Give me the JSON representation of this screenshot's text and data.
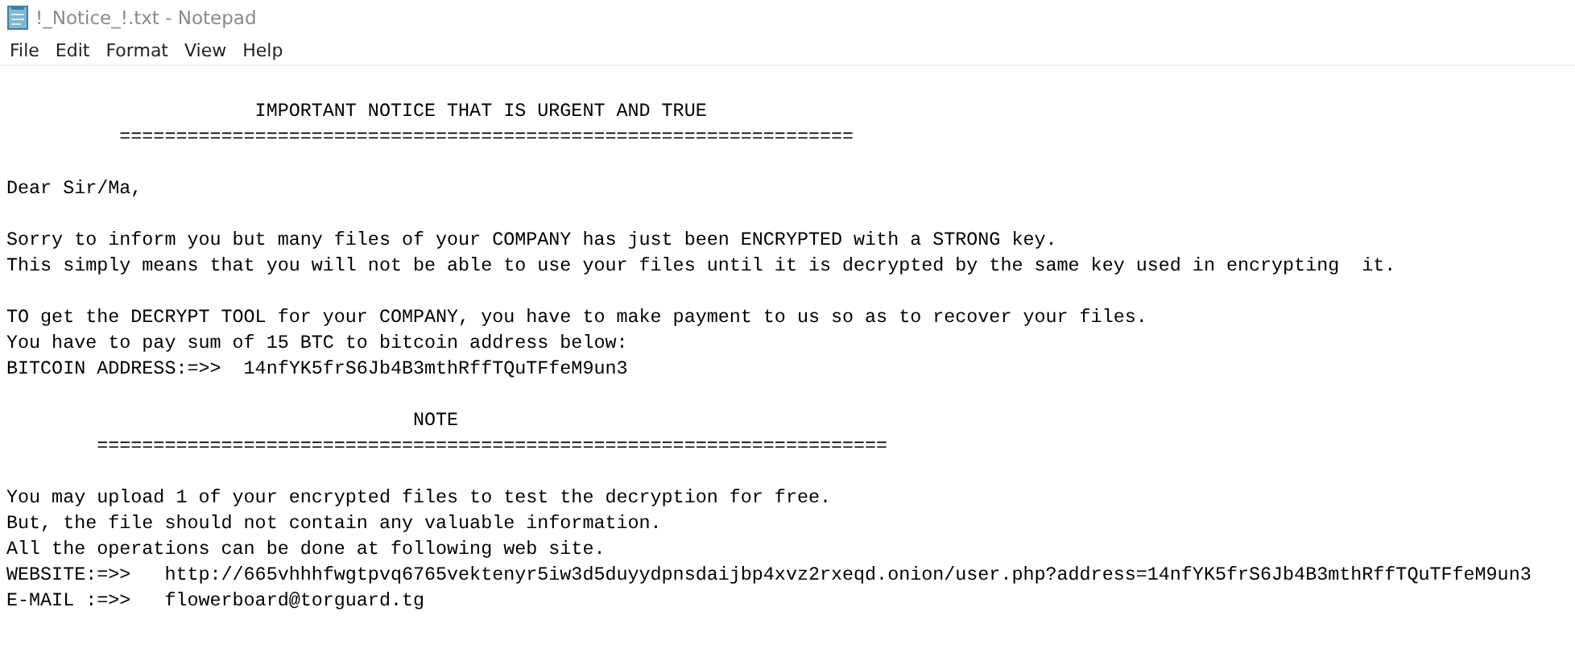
{
  "window": {
    "title": "!_Notice_!.txt - Notepad"
  },
  "menu": [
    "File",
    "Edit",
    "Format",
    "View",
    "Help"
  ],
  "paragraphs": [
    [
      "                      IMPORTANT NOTICE THAT IS URGENT AND TRUE",
      "          ================================================================="
    ],
    [
      "Dear Sir/Ma,"
    ],
    [
      "Sorry to inform you but many files of your COMPANY has just been ENCRYPTED with a STRONG key.",
      "This simply means that you will not be able to use your files until it is decrypted by the same key used in encrypting  it."
    ],
    [
      "TO get the DECRYPT TOOL for your COMPANY, you have to make payment to us so as to recover your files.",
      "You have to pay sum of 15 BTC to bitcoin address below:",
      "BITCOIN ADDRESS:=>>  14nfYK5frS6Jb4B3mthRffTQuTFfeM9un3"
    ],
    [
      "                                    NOTE",
      "        ======================================================================"
    ],
    [
      "You may upload 1 of your encrypted files to test the decryption for free.",
      "But, the file should not contain any valuable information.",
      "All the operations can be done at following web site.",
      "WEBSITE:=>>   http://665vhhhfwgtpvq6765vektenyr5iw3d5duyydpnsdaijbp4xvz2rxeqd.onion/user.php?address=14nfYK5frS6Jb4B3mthRffTQuTFfeM9un3",
      "E-MAIL :=>>   flowerboard@torguard.tg"
    ]
  ]
}
